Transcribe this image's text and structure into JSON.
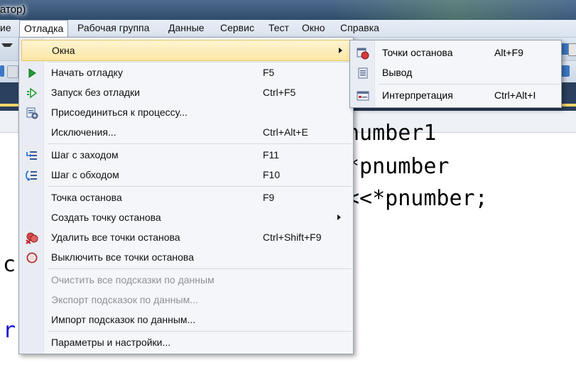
{
  "window": {
    "title_fragment": "атор)"
  },
  "menubar": {
    "items": [
      {
        "label": "иe"
      },
      {
        "label": "Отладка"
      },
      {
        "label": "Рабочая группа"
      },
      {
        "label": "Данные"
      },
      {
        "label": "Сервис"
      },
      {
        "label": "Тест"
      },
      {
        "label": "Окно"
      },
      {
        "label": "Справка"
      }
    ]
  },
  "debug_menu": {
    "items": [
      {
        "label": "Окна",
        "shortcut": "",
        "icon": "none",
        "submenu": true,
        "highlighted": true
      },
      {
        "label": "Начать отладку",
        "shortcut": "F5",
        "icon": "play-icon"
      },
      {
        "label": "Запуск без отладки",
        "shortcut": "Ctrl+F5",
        "icon": "play-outline-icon"
      },
      {
        "label": "Присоединиться к процессу...",
        "shortcut": "",
        "icon": "attach-process-icon"
      },
      {
        "label": "Исключения...",
        "shortcut": "Ctrl+Alt+E",
        "icon": "none"
      },
      {
        "label": "Шаг с заходом",
        "shortcut": "F11",
        "icon": "step-into-icon"
      },
      {
        "label": "Шаг с обходом",
        "shortcut": "F10",
        "icon": "step-over-icon"
      },
      {
        "label": "Точка останова",
        "shortcut": "F9",
        "icon": "none"
      },
      {
        "label": "Создать точку останова",
        "shortcut": "",
        "icon": "none",
        "submenu": true
      },
      {
        "label": "Удалить все точки останова",
        "shortcut": "Ctrl+Shift+F9",
        "icon": "delete-breakpoints-icon"
      },
      {
        "label": "Выключить все точки останова",
        "shortcut": "",
        "icon": "disable-breakpoints-icon"
      },
      {
        "label": "Очистить все подсказки по данным",
        "shortcut": "",
        "icon": "none",
        "disabled": true
      },
      {
        "label": "Экспорт подсказок по данным...",
        "shortcut": "",
        "icon": "none",
        "disabled": true
      },
      {
        "label": "Импорт подсказок по данным...",
        "shortcut": "",
        "icon": "none"
      },
      {
        "label": "Параметры и настройки...",
        "shortcut": "",
        "icon": "none"
      }
    ]
  },
  "windows_submenu": {
    "items": [
      {
        "label": "Точки останова",
        "shortcut": "Alt+F9",
        "icon": "breakpoints-window-icon"
      },
      {
        "label": "Вывод",
        "shortcut": "",
        "icon": "output-window-icon"
      },
      {
        "label": "Интерпретация",
        "shortcut": "Ctrl+Alt+I",
        "icon": "immediate-window-icon"
      }
    ]
  },
  "editor": {
    "lines": [
      {
        "text": "number1"
      },
      {
        "text": "*pnumber"
      },
      {
        "text": "<<*pnumber;"
      },
      {
        "text": "c"
      },
      {
        "text": "r"
      }
    ]
  }
}
